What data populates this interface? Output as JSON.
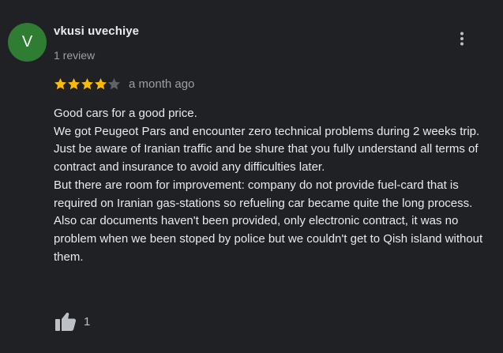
{
  "review": {
    "avatar_letter": "V",
    "avatar_color": "#2e7d32",
    "author_name": "vkusi uvechiye",
    "review_count": "1 review",
    "rating": 4,
    "rating_max": 5,
    "date": "a month ago",
    "text_lines": [
      "Good cars for a good price.",
      "We got Peugeot Pars and encounter zero technical problems during 2 weeks trip.",
      "Just be aware of Iranian traffic and be shure that you fully understand all terms of contract and insurance to avoid any difficulties later.",
      "But there are room for improvement: company do not provide fuel-card that is required on Iranian gas-stations so refueling car became quite the long process.",
      "Also car documents haven't been provided, only electronic contract, it was no problem when we been stoped by police but we couldn't get to Qish island without them."
    ],
    "likes": "1"
  },
  "icons": {
    "more": "more-vert-icon",
    "star_filled": "star-filled-icon",
    "star_empty": "star-empty-icon",
    "like": "thumbs-up-icon"
  },
  "colors": {
    "background": "#202124",
    "star_filled": "#fbbc04",
    "star_empty": "#5f6368",
    "text_primary": "#e8eaed",
    "text_secondary": "#9aa0a6"
  }
}
